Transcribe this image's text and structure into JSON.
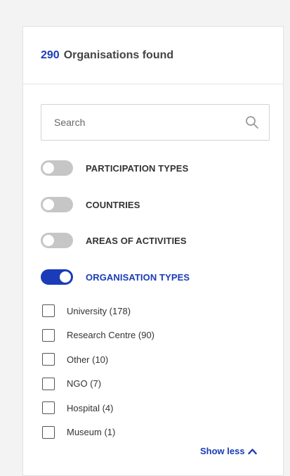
{
  "header": {
    "count": "290",
    "label": "Organisations found"
  },
  "search": {
    "placeholder": "Search",
    "value": ""
  },
  "filters": [
    {
      "label": "PARTICIPATION TYPES",
      "on": false
    },
    {
      "label": "COUNTRIES",
      "on": false
    },
    {
      "label": "AREAS OF ACTIVITIES",
      "on": false
    },
    {
      "label": "ORGANISATION TYPES",
      "on": true
    }
  ],
  "organisation_types": [
    {
      "label": "University (178)",
      "checked": false
    },
    {
      "label": "Research Centre (90)",
      "checked": false
    },
    {
      "label": "Other (10)",
      "checked": false
    },
    {
      "label": "NGO (7)",
      "checked": false
    },
    {
      "label": "Hospital (4)",
      "checked": false
    },
    {
      "label": "Museum (1)",
      "checked": false
    }
  ],
  "show_less_label": "Show less",
  "colors": {
    "accent": "#1a3cb8",
    "toggle_off": "#c6c6c6"
  },
  "icons": {
    "search": "search-icon",
    "show_less": "chevron-up-icon"
  }
}
